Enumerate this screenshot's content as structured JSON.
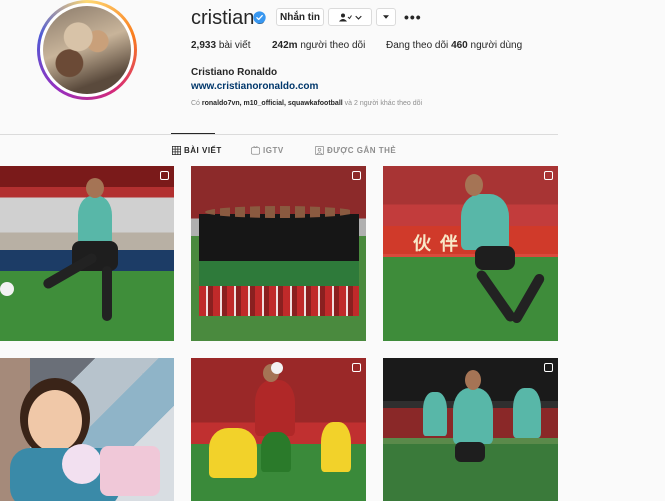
{
  "profile": {
    "username": "cristiano",
    "full_name": "Cristiano Ronaldo",
    "website": "www.cristianoronaldo.com",
    "message_button": "Nhắn tin",
    "stats": {
      "posts_count": "2,933",
      "posts_label": "bài viết",
      "followers_count": "242m",
      "followers_label": "người theo dõi",
      "following_prefix": "Đang theo dõi",
      "following_count": "460",
      "following_label": "người dùng"
    },
    "followed_by": {
      "prefix": "Có",
      "names": "ronaldo7vn, m10_official, squawkafootball",
      "suffix": "và 2 người khác theo dõi"
    }
  },
  "tabs": [
    {
      "label": "BÀI VIẾT",
      "icon": "grid-icon",
      "active": true
    },
    {
      "label": "IGTV",
      "icon": "igtv-icon",
      "active": false
    },
    {
      "label": "ĐƯỢC GẮN THẺ",
      "icon": "tagged-icon",
      "active": false
    }
  ],
  "colors": {
    "accent_link": "#00376b",
    "verified_blue": "#3897f0",
    "text": "#262626",
    "muted": "#8e8e8e",
    "border": "#dbdbdb"
  },
  "posts": [
    {
      "id": "post-1",
      "multi": true
    },
    {
      "id": "post-2",
      "multi": true
    },
    {
      "id": "post-3",
      "multi": true
    },
    {
      "id": "post-4",
      "multi": false
    },
    {
      "id": "post-5",
      "multi": true
    },
    {
      "id": "post-6",
      "multi": true
    }
  ]
}
